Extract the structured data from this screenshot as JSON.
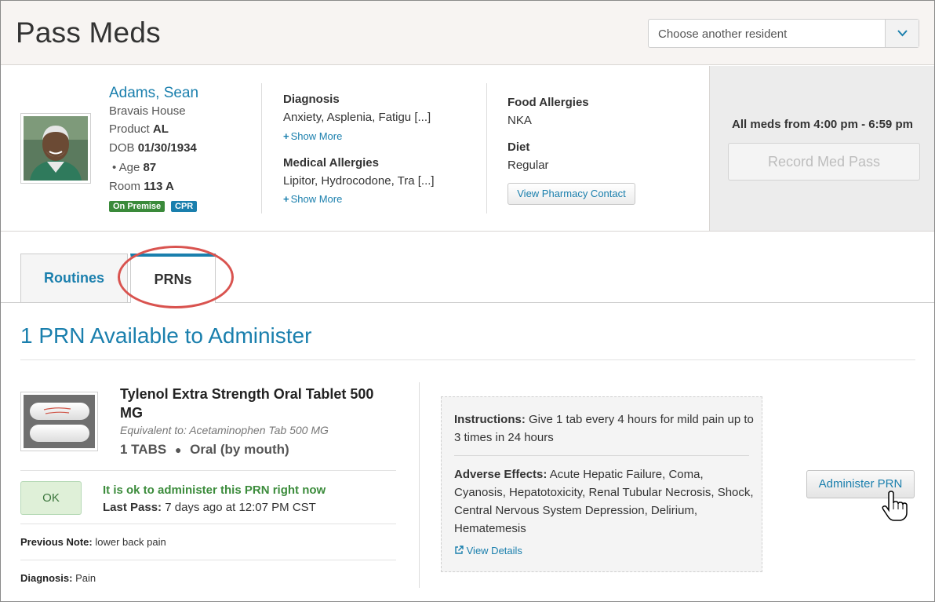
{
  "header": {
    "title": "Pass Meds",
    "resident_select_placeholder": "Choose another resident"
  },
  "resident": {
    "name": "Adams, Sean",
    "house": "Bravais House",
    "product_label": "Product",
    "product": "AL",
    "dob_label": "DOB",
    "dob": "01/30/1934",
    "age_label": "Age",
    "age": "87",
    "room_label": "Room",
    "room": "113 A",
    "badges": [
      {
        "label": "On Premise",
        "color": "#3a8a3a"
      },
      {
        "label": "CPR",
        "color": "#1a7fad"
      }
    ]
  },
  "medical": {
    "diagnosis_label": "Diagnosis",
    "diagnosis": "Anxiety, Asplenia, Fatigu [...]",
    "show_more": "Show More",
    "allergies_label": "Medical Allergies",
    "allergies": "Lipitor, Hydrocodone, Tra [...]",
    "food_allergies_label": "Food Allergies",
    "food_allergies": "NKA",
    "diet_label": "Diet",
    "diet": "Regular",
    "pharmacy_button": "View Pharmacy Contact"
  },
  "side_panel": {
    "all_meds": "All meds from 4:00 pm - 6:59 pm",
    "record_button": "Record Med Pass"
  },
  "tabs": [
    {
      "label": "Routines",
      "active": false
    },
    {
      "label": "PRNs",
      "active": true
    }
  ],
  "prn": {
    "section_title": "1 PRN Available to Administer",
    "med_name": "Tylenol Extra Strength Oral Tablet 500 MG",
    "equivalent": "Equivalent to: Acetaminophen Tab 500 MG",
    "dose": "1 TABS",
    "route": "Oral (by mouth)",
    "ok_button": "OK",
    "ok_message": "It is ok to administer this PRN right now",
    "last_pass_label": "Last Pass:",
    "last_pass": "7 days ago at 12:07 PM CST",
    "previous_note_label": "Previous Note:",
    "previous_note": "lower back pain",
    "diagnosis_label": "Diagnosis:",
    "diagnosis": "Pain",
    "instructions_label": "Instructions:",
    "instructions": "Give 1 tab every 4 hours for mild pain up to 3 times in 24 hours",
    "adverse_label": "Adverse Effects:",
    "adverse": "Acute Hepatic Failure, Coma, Cyanosis, Hepatotoxicity, Renal Tubular Necrosis, Shock, Central Nervous System Depression, Delirium, Hematemesis",
    "view_details": "View Details",
    "administer_button": "Administer PRN"
  }
}
